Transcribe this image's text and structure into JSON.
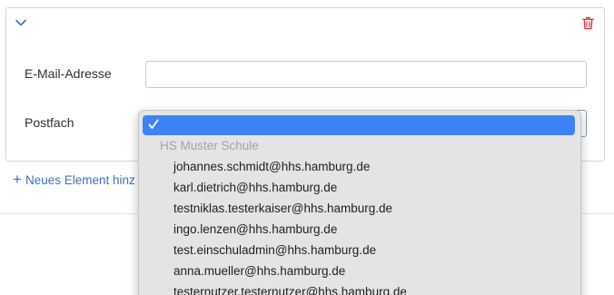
{
  "form": {
    "email_label": "E-Mail-Adresse",
    "email_value": "",
    "postfach_label": "Postfach",
    "add_element_label": "Neues Element hinz"
  },
  "dropdown": {
    "selected_option": "",
    "group_label": "HS Muster Schule",
    "options": [
      "johannes.schmidt@hhs.hamburg.de",
      "karl.dietrich@hhs.hamburg.de",
      "testniklas.testerkaiser@hhs.hamburg.de",
      "ingo.lenzen@hhs.hamburg.de",
      "test.einschuladmin@hhs.hamburg.de",
      "anna.mueller@hhs.hamburg.de",
      "testernutzer.testernutzer@hhs.hamburg.de"
    ]
  },
  "icons": {
    "collapse": "chevron-down-icon",
    "delete": "trash-icon",
    "add": "plus-icon",
    "selected": "checkmark-icon"
  },
  "colors": {
    "accent": "#3d72b8",
    "danger": "#d9363e",
    "selection": "#3d83f5"
  }
}
